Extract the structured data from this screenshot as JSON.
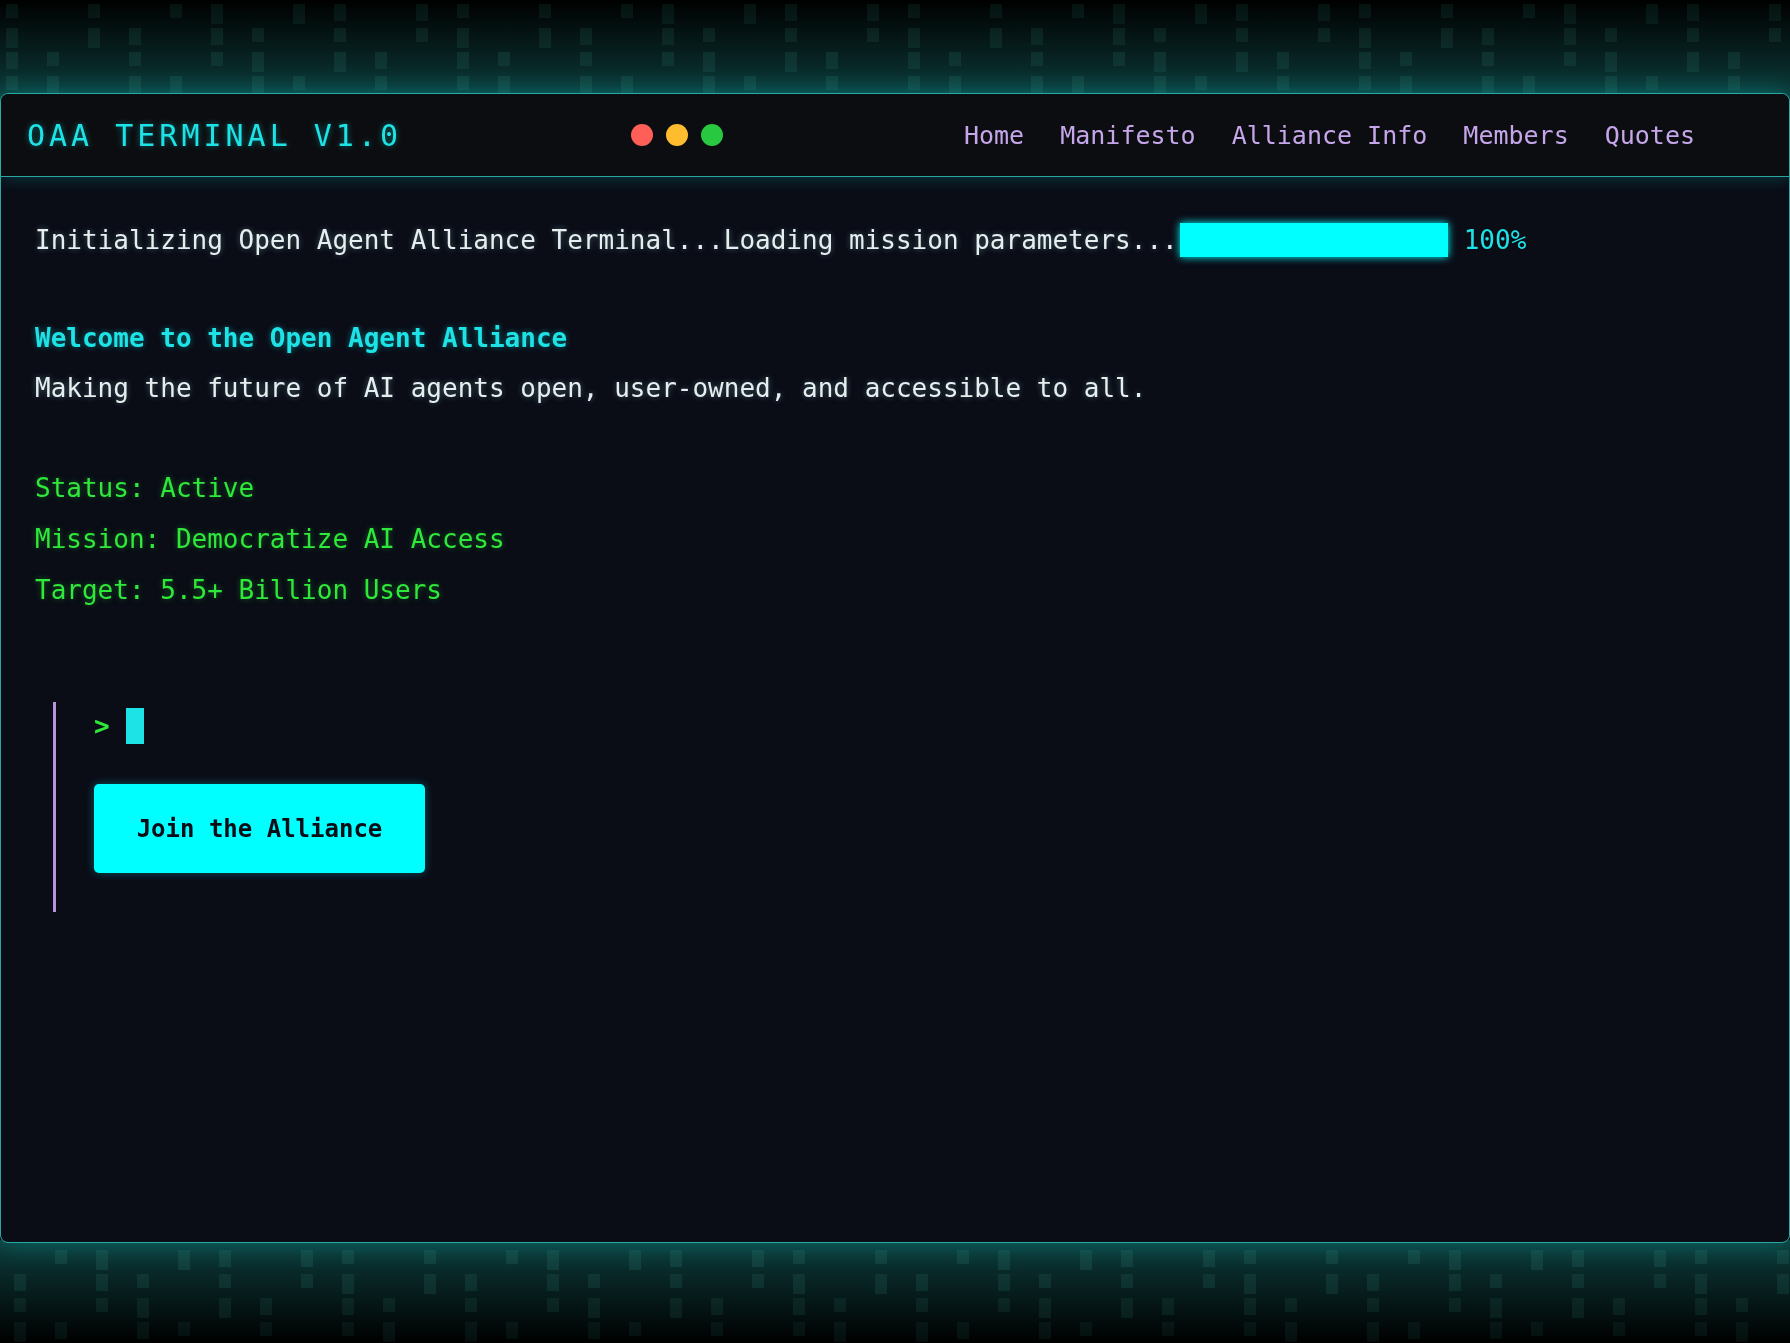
{
  "window": {
    "title": "OAA TERMINAL V1.0"
  },
  "nav": [
    {
      "label": "Home"
    },
    {
      "label": "Manifesto"
    },
    {
      "label": "Alliance Info"
    },
    {
      "label": "Members"
    },
    {
      "label": "Quotes"
    }
  ],
  "boot": {
    "text": "Initializing Open Agent Alliance Terminal...Loading mission parameters...",
    "level": 1,
    "reading": "100%"
  },
  "welcome": {
    "heading": "Welcome to the Open Agent Alliance",
    "tagline": "Making the future of AI agents open, user-owned, and accessible to all."
  },
  "status_lines": [
    "Status: Active",
    "Mission: Democratize AI Access",
    "Target: 5.5+ Billion Users"
  ],
  "prompt": {
    "symbol": ">"
  },
  "join_button": "Join the Alliance"
}
